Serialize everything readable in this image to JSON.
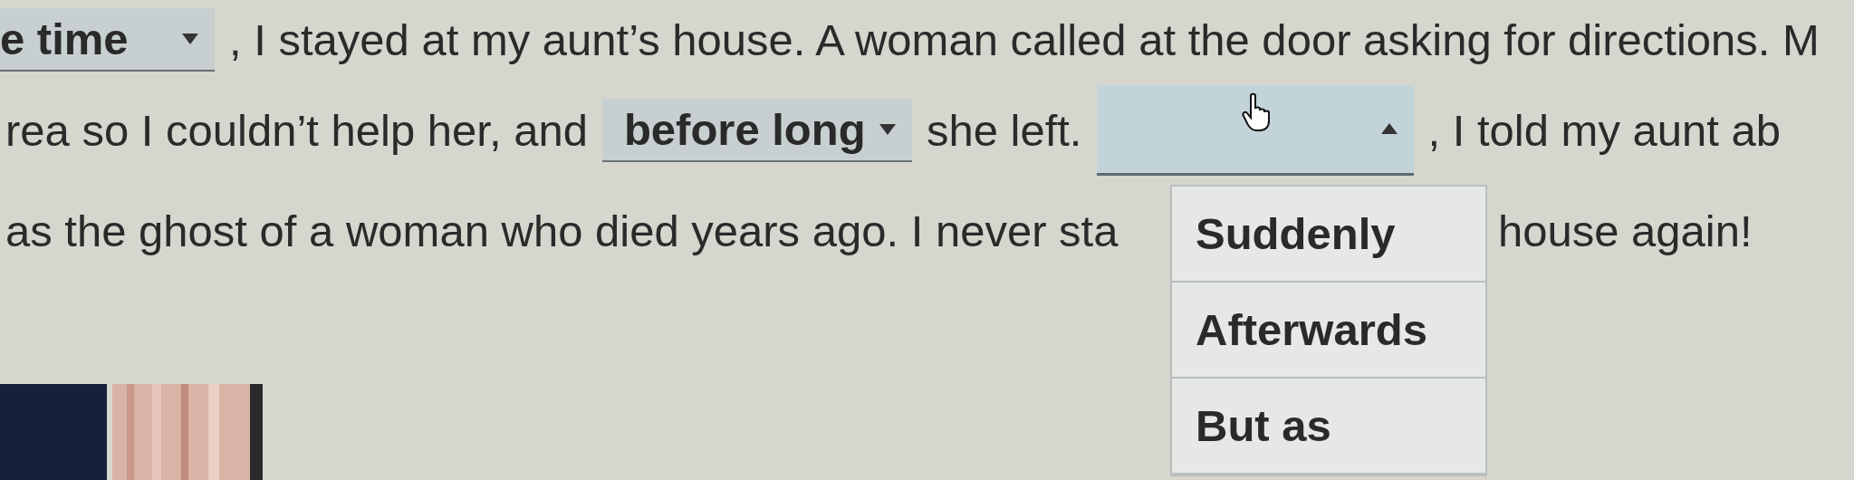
{
  "lines": [
    {
      "segments": [
        {
          "kind": "dropdown",
          "value": "e time",
          "open": false
        },
        {
          "kind": "text",
          "text": ", I stayed at my aunt’s house. A woman called at the door asking for directions. M"
        }
      ]
    },
    {
      "segments": [
        {
          "kind": "text",
          "text": "rea so I couldn’t help her, and"
        },
        {
          "kind": "dropdown",
          "value": "before long",
          "open": false
        },
        {
          "kind": "text",
          "text": "she left."
        },
        {
          "kind": "dropdown",
          "open": true
        },
        {
          "kind": "text",
          "text": ", I told my aunt ab"
        }
      ]
    },
    {
      "segments": [
        {
          "kind": "text",
          "text": "as the ghost of a woman who died years ago. I never sta"
        },
        {
          "kind": "gap"
        },
        {
          "kind": "text",
          "text": "house again!"
        }
      ]
    }
  ],
  "menu": {
    "options": [
      {
        "label": "Suddenly",
        "selected": false
      },
      {
        "label": "Afterwards",
        "selected": false
      },
      {
        "label": "But as",
        "selected": false
      }
    ]
  }
}
